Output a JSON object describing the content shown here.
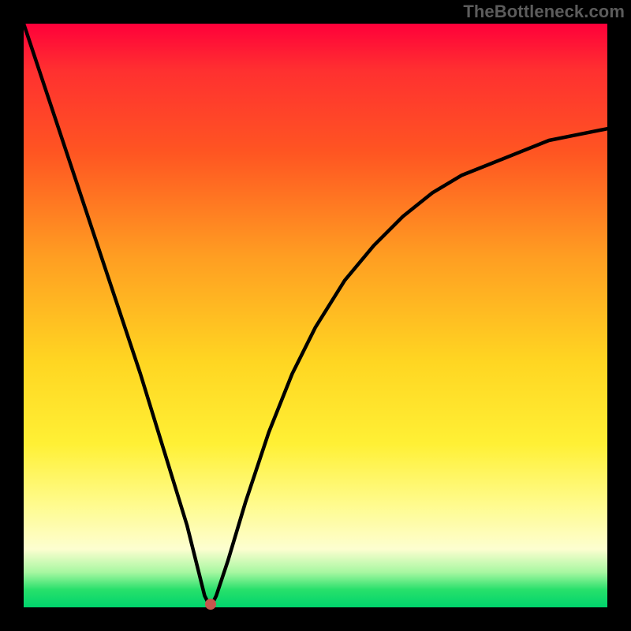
{
  "watermark": "TheBottleneck.com",
  "colors": {
    "background": "#000000",
    "curve_stroke": "#000000",
    "marker_fill": "#c6564d",
    "gradient": [
      "#ff003a",
      "#ff3030",
      "#ff5522",
      "#ff9e22",
      "#ffd622",
      "#fff035",
      "#fffb8a",
      "#fdfed0",
      "#a7f7a1",
      "#27e06b",
      "#00d46c"
    ]
  },
  "chart_data": {
    "type": "line",
    "title": "",
    "xlabel": "",
    "ylabel": "",
    "xlim": [
      0,
      100
    ],
    "ylim": [
      0,
      100
    ],
    "grid": false,
    "legend": false,
    "note": "V-shaped bottleneck curve; y-axis encodes bottleneck severity via background color (green=low near bottom, red=high near top). Minimum at x≈32 where curve touches y=0. Marker dot at minimum.",
    "series": [
      {
        "name": "bottleneck-curve",
        "x": [
          0,
          4,
          8,
          12,
          16,
          20,
          24,
          28,
          30,
          31,
          32,
          33,
          35,
          38,
          42,
          46,
          50,
          55,
          60,
          65,
          70,
          75,
          80,
          85,
          90,
          95,
          100
        ],
        "values": [
          100,
          88,
          76,
          64,
          52,
          40,
          27,
          14,
          6,
          2,
          0,
          2,
          8,
          18,
          30,
          40,
          48,
          56,
          62,
          67,
          71,
          74,
          76,
          78,
          80,
          81,
          82
        ]
      }
    ],
    "marker": {
      "x": 32,
      "y": 0
    }
  }
}
